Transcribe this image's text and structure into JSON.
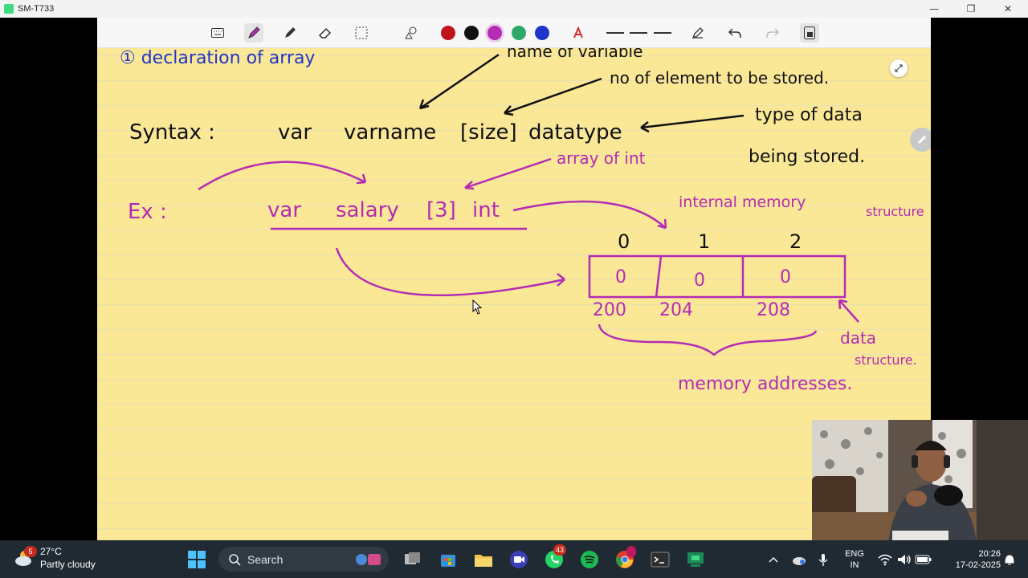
{
  "window": {
    "title": "SM-T733",
    "minimize": "—",
    "maximize": "❐",
    "close": "✕"
  },
  "toolbar": {
    "tools": [
      "keyboard-icon",
      "pen-icon",
      "highlighter-icon",
      "eraser-icon",
      "lasso-select-icon",
      "shapes-icon",
      "text-recognition-icon",
      "line-style-1",
      "line-style-2",
      "line-style-3",
      "edit-pen-icon",
      "undo-icon",
      "redo-icon",
      "page-icon"
    ],
    "colors": {
      "red": "#c0141c",
      "black": "#111111",
      "purple": "#b42bb4",
      "green": "#2ea86a",
      "blue": "#1f34c8"
    },
    "selected_color": "purple"
  },
  "notes": {
    "heading": "① declaration of array",
    "annotation_name": "name of variable",
    "annotation_count": "no of element to be stored.",
    "syntax_label": "Syntax :",
    "syntax_var": "var",
    "syntax_varname": "varname",
    "syntax_size": "[size]",
    "syntax_datatype": "datatype",
    "annotation_type_1": "type of data",
    "annotation_type_2": "being stored.",
    "annotation_array_of_int": "array of int",
    "example_label": "Ex :",
    "example_var": "var",
    "example_salary": "salary",
    "example_size": "[3]",
    "example_type": "int",
    "internal_memory": "internal memory",
    "structure": "structure",
    "indices": [
      "0",
      "1",
      "2"
    ],
    "cells": [
      "0",
      "0",
      "0"
    ],
    "addresses": [
      "200",
      "204",
      "208"
    ],
    "data_structure_1": "data",
    "data_structure_2": "structure.",
    "memory_addresses": "memory addresses."
  },
  "taskbar": {
    "weather_temp": "27°C",
    "weather_desc": "Partly cloudy",
    "weather_badge": "5",
    "search": "Search",
    "whatsapp_badge": "43",
    "lang_1": "ENG",
    "lang_2": "IN",
    "time": "20:26",
    "date": "17-02-2025"
  }
}
